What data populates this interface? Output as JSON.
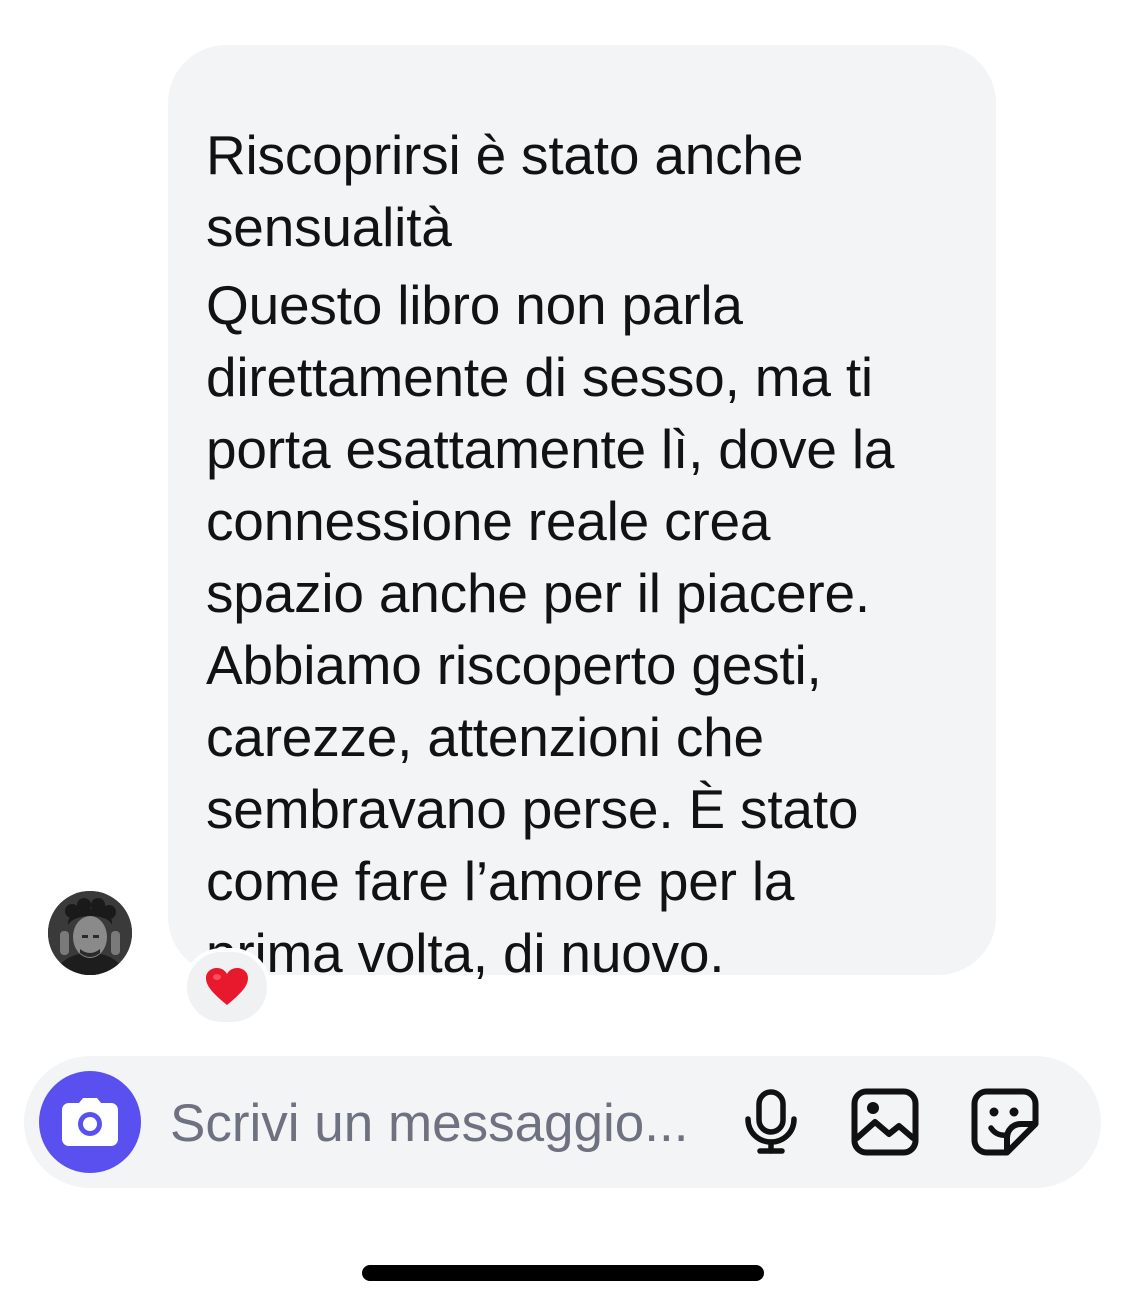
{
  "conversation": {
    "message": {
      "lines": [
        "Riscoprirsi è stato anche",
        "sensualità",
        "Questo libro non parla",
        "direttamente di sesso, ma ti",
        "porta esattamente lì, dove la",
        "connessione reale crea",
        "spazio anche per il piacere.",
        "Abbiamo riscoperto gesti,",
        "carezze, attenzioni che",
        "sembravano perse. È stato",
        "come fare l’amore per la",
        "prima volta, di nuovo."
      ],
      "reaction": "❤️",
      "bubble_color": "#f3f4f6"
    },
    "avatar_icon": "user-avatar-photo"
  },
  "composer": {
    "placeholder": "Scrivi un messaggio...",
    "value": "",
    "camera_icon": "camera-icon",
    "camera_color": "#5a50ef",
    "tools": [
      "microphone-icon",
      "gallery-icon",
      "sticker-icon"
    ]
  }
}
